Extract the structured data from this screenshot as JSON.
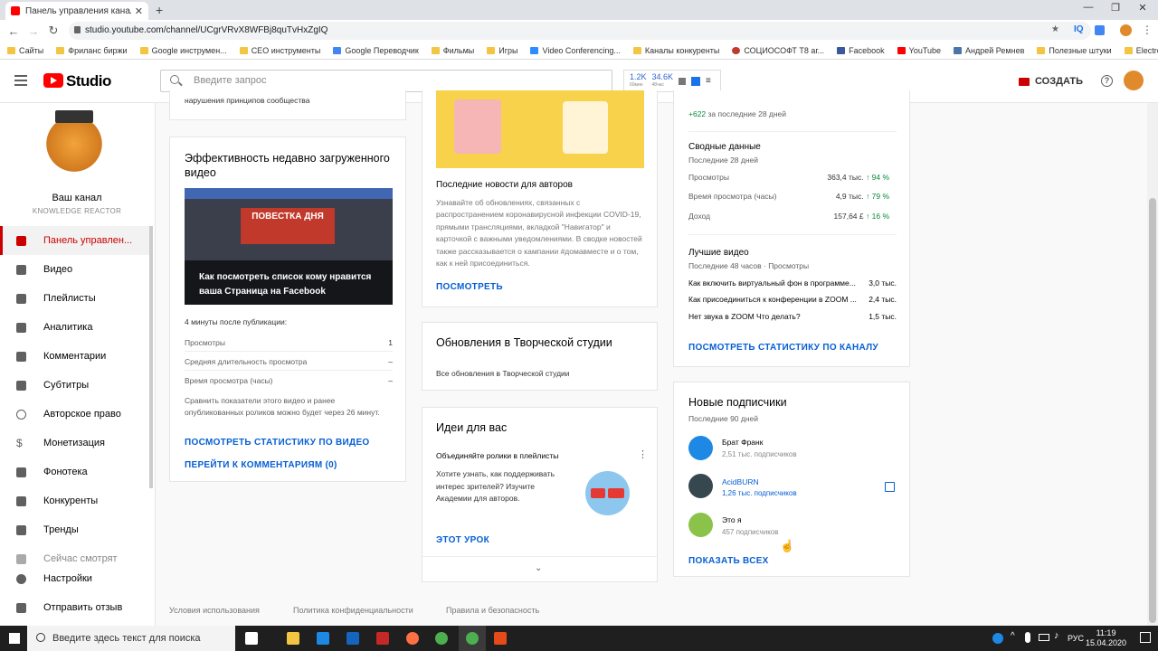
{
  "browser": {
    "tab_title": "Панель управления каналом - Y",
    "url": "studio.youtube.com/channel/UCgrVRvX8WFBj8quTvHxZgIQ",
    "bookmarks": [
      "Сайты",
      "Фриланс биржи",
      "Google инструмен...",
      "СЕО инструменты",
      "Google Переводчик",
      "Фильмы",
      "Игры",
      "Video Conferencing...",
      "Каналы конкуренты",
      "СОЦИОСОФТ T8 аг...",
      "Facebook",
      "YouTube",
      "Андрей Ремнев",
      "Полезные штуки",
      "Electronics, Cars, Fa..."
    ]
  },
  "header": {
    "logo_text": "Studio",
    "search_placeholder": "Введите запрос",
    "stat1": "1.2K",
    "stat1_sub": "60мин",
    "stat2": "34.6K",
    "stat2_sub": "48час",
    "create_label": "СОЗДАТЬ"
  },
  "sidebar": {
    "channel_name": "Ваш канал",
    "channel_sub": "KNOWLEDGE REACTOR",
    "items": [
      {
        "label": "Панель управлен..."
      },
      {
        "label": "Видео"
      },
      {
        "label": "Плейлисты"
      },
      {
        "label": "Аналитика"
      },
      {
        "label": "Комментарии"
      },
      {
        "label": "Субтитры"
      },
      {
        "label": "Авторское право"
      },
      {
        "label": "Монетизация"
      },
      {
        "label": "Фонотека"
      },
      {
        "label": "Конкуренты"
      },
      {
        "label": "Тренды"
      },
      {
        "label": "Сейчас смотрят"
      },
      {
        "label": "Настройки"
      },
      {
        "label": "Отправить отзыв"
      }
    ]
  },
  "col1": {
    "top_text": "нарушения принципов сообщества",
    "title": "Эффективность недавно загруженного видео",
    "thumb_banner": "ПОВЕСТКА ДНЯ",
    "thumb_caption": "Как посмотреть список кому нравится ваша Страница на Facebook",
    "since": "4 минуты после публикации:",
    "rows": [
      {
        "label": "Просмотры",
        "value": "1"
      },
      {
        "label": "Средняя длительность просмотра",
        "value": "–"
      },
      {
        "label": "Время просмотра (часы)",
        "value": "–"
      }
    ],
    "note": "Сравнить показатели этого видео и ранее опубликованных роликов можно будет через 26 минут.",
    "link1": "ПОСМОТРЕТЬ СТАТИСТИКУ ПО ВИДЕО",
    "link2": "ПЕРЕЙТИ К КОММЕНТАРИЯМ (0)"
  },
  "col2": {
    "news_title": "Последние новости для авторов",
    "news_text": "Узнавайте об обновлениях, связанных с распространением коронавирусной инфекции COVID-19, прямыми трансляциями, вкладкой \"Навигатор\" и карточкой с важными уведомлениями. В сводке новостей также рассказывается о кампании #домавместе и о том, как к ней присоединиться.",
    "news_link": "ПОСМОТРЕТЬ",
    "updates_title": "Обновления в Творческой студии",
    "updates_text": "Все обновления в Творческой студии",
    "ideas_title": "Идеи для вас",
    "ideas_sub": "Объединяйте ролики в плейлисты",
    "ideas_text": "Хотите узнать, как поддерживать интерес зрителей? Изучите Академии для авторов.",
    "ideas_link": "ЭТОТ УРОК"
  },
  "col3": {
    "delta": "+622",
    "delta_label": "за последние 28 дней",
    "summary_title": "Сводные данные",
    "summary_sub": "Последние 28 дней",
    "summary_rows": [
      {
        "label": "Просмотры",
        "value": "363,4 тыс.",
        "pct": "94 %"
      },
      {
        "label": "Время просмотра (часы)",
        "value": "4,9 тыс.",
        "pct": "79 %"
      },
      {
        "label": "Доход",
        "value": "157,64 £",
        "pct": "16 %"
      }
    ],
    "top_title": "Лучшие видео",
    "top_sub": "Последние 48 часов · Просмотры",
    "top_rows": [
      {
        "label": "Как включить виртуальный фон в программе...",
        "value": "3,0 тыс."
      },
      {
        "label": "Как присоединиться к конференции в ZOOM ...",
        "value": "2,4 тыс."
      },
      {
        "label": "Нет звука в ZOOM Что делать?",
        "value": "1,5 тыс."
      }
    ],
    "channel_link": "ПОСМОТРЕТЬ СТАТИСТИКУ ПО КАНАЛУ",
    "subs_title": "Новые подписчики",
    "subs_sub": "Последние 90 дней",
    "subs": [
      {
        "name": "Брат Франк",
        "count": "2,51 тыс. подписчиков"
      },
      {
        "name": "AcidBURN",
        "count": "1,26 тыс. подписчиков"
      },
      {
        "name": "Это я",
        "count": "457 подписчиков"
      }
    ],
    "subs_link": "ПОКАЗАТЬ ВСЕХ"
  },
  "footer": [
    "Условия использования",
    "Политика конфиденциальности",
    "Правила и безопасность"
  ],
  "taskbar": {
    "search_placeholder": "Введите здесь текст для поиска",
    "lang": "РУС",
    "time": "11:19",
    "date": "15.04.2020"
  }
}
